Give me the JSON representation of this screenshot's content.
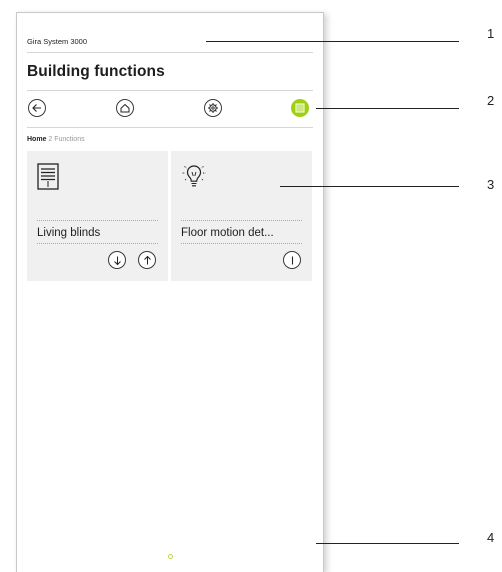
{
  "app": {
    "system_title": "Gira System 3000",
    "page_title": "Building functions"
  },
  "nav": {
    "buttons": [
      {
        "icon": "back-arrow-icon"
      },
      {
        "icon": "home-icon"
      },
      {
        "icon": "settings-gear-icon"
      },
      {
        "icon": "grid-functions-icon",
        "active": true
      }
    ],
    "active_color": "#9ed10f"
  },
  "breadcrumb": {
    "home": "Home",
    "current": "2 Functions"
  },
  "tiles": [
    {
      "icon": "blinds-icon",
      "name": "Living blinds",
      "controls": [
        "arrow-down-icon",
        "arrow-up-icon"
      ]
    },
    {
      "icon": "bulb-motion-icon",
      "name": "Floor motion det...",
      "controls": [
        "toggle-bar-icon"
      ]
    }
  ],
  "callouts": [
    "1",
    "2",
    "3",
    "4"
  ]
}
